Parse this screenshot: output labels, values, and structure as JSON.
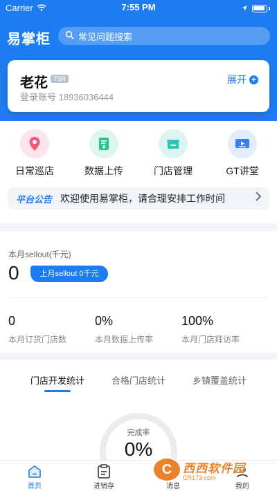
{
  "status_bar": {
    "carrier": "Carrier",
    "time": "7:55 PM"
  },
  "header": {
    "app_name": "易掌柜",
    "search_placeholder": "常见问题搜索"
  },
  "user": {
    "name": "老花",
    "badge": "TSR",
    "account": "登录账号 18936036444",
    "expand_label": "展开"
  },
  "menu": [
    {
      "label": "日常巡店",
      "icon": "location-pin-icon",
      "color": "#f2557a"
    },
    {
      "label": "数据上传",
      "icon": "upload-doc-icon",
      "color": "#2bc48a"
    },
    {
      "label": "门店管理",
      "icon": "store-icon",
      "color": "#2ec2b0"
    },
    {
      "label": "GT讲堂",
      "icon": "video-icon",
      "color": "#3a7ff0"
    }
  ],
  "notice": {
    "tag": "平台公告",
    "text": "欢迎使用易掌柜，请合理安排工作时间"
  },
  "stats": {
    "title": "本月sellout(千元)",
    "value": "0",
    "last_month": "上月sellout 0千元",
    "metrics": [
      {
        "value": "0",
        "label": "本月订货门店数"
      },
      {
        "value": "0%",
        "label": "本月数据上传率"
      },
      {
        "value": "100%",
        "label": "本月门店拜访率"
      }
    ]
  },
  "tabs": [
    "门店开发统计",
    "合格门店统计",
    "乡镇覆盖统计"
  ],
  "gauge": {
    "label": "完成率",
    "value": "0%",
    "percent": 0
  },
  "tabbar": [
    "首页",
    "进销存",
    "消息",
    "我的"
  ],
  "watermark": {
    "main": "西西软件园",
    "sub": "CR173.com",
    "logo": "C"
  },
  "colors": {
    "brand": "#1d7df0",
    "watermark": "#e9832b"
  }
}
